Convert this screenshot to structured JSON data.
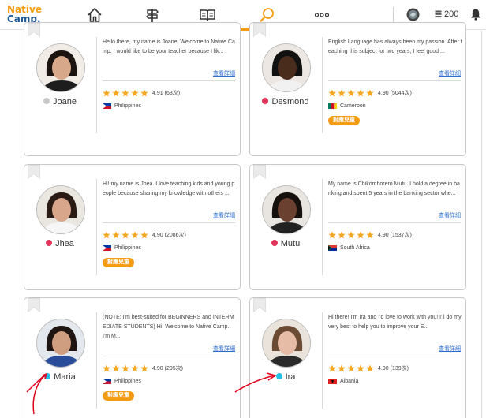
{
  "logo": {
    "line1": "Native",
    "line2": "Camp."
  },
  "nav": {
    "points_value": "200"
  },
  "teachers": [
    {
      "name": "Joane",
      "status": "offline",
      "status_color": "#c8c8c8",
      "intro": "Hello there, my name is Joane! Welcome to Native Camp. I would like to be your teacher because I lik...",
      "detail_label": "查看詳細",
      "rating": "4.91",
      "reviews": "(63次)",
      "country": "Philippines",
      "badge": ""
    },
    {
      "name": "Desmond",
      "status": "busy",
      "status_color": "#e0345a",
      "intro": "English Language has always been my passion. After teaching this subject for two years, I feel good ...",
      "detail_label": "查看詳細",
      "rating": "4.90",
      "reviews": "(5044次)",
      "country": "Cameroon",
      "badge": "對應兒童"
    },
    {
      "name": "Jhea",
      "status": "busy",
      "status_color": "#e0345a",
      "intro": "Hi! my name is Jhea. I love teaching kids and young people because sharing my knowledge with others ...",
      "detail_label": "查看詳細",
      "rating": "4.90",
      "reviews": "(2086次)",
      "country": "Philippines",
      "badge": "對應兒童"
    },
    {
      "name": "Mutu",
      "status": "busy",
      "status_color": "#e0345a",
      "intro": "My name is Chikomborero Mutu. I hold a degree in banking and spent 5 years in the banking sector whe...",
      "detail_label": "查看詳細",
      "rating": "4.90",
      "reviews": "(1537次)",
      "country": "South Africa",
      "badge": ""
    },
    {
      "name": "Maria",
      "status": "available",
      "status_color": "#23c0e8",
      "intro": "(NOTE: I'm best-suited for BEGINNERS and INTERMEDIATE STUDENTS) Hi! Welcome to Native Camp. I'm M...",
      "detail_label": "查看詳細",
      "rating": "4.90",
      "reviews": "(295次)",
      "country": "Philippines",
      "badge": "對應兒童"
    },
    {
      "name": "Ira",
      "status": "available",
      "status_color": "#23c0e8",
      "intro": "Hi there! I'm Ira and I'd love to work with you! I'll do my very best to help you to improve your E...",
      "detail_label": "查看詳細",
      "rating": "4.90",
      "reviews": "(139次)",
      "country": "Albania",
      "badge": ""
    }
  ],
  "colors": {
    "accent": "#f39c12",
    "star": "#f5a623",
    "link": "#2f6fd0",
    "annotation_arrow": "#e0001a"
  },
  "icons": [
    "home-icon",
    "signpost-icon",
    "book-icon",
    "search-icon",
    "more-icon",
    "coin-icon",
    "stack-icon",
    "bell-icon",
    "bookmark-icon",
    "star-icon"
  ]
}
